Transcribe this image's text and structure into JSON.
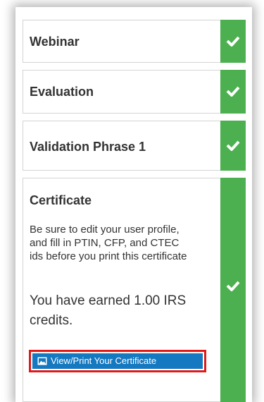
{
  "steps": [
    {
      "title": "Webinar",
      "status": "complete",
      "icon": "checkmark-icon"
    },
    {
      "title": "Evaluation",
      "status": "complete",
      "icon": "checkmark-icon"
    },
    {
      "title": "Validation Phrase 1",
      "status": "complete",
      "icon": "checkmark-icon"
    },
    {
      "title": "Certificate",
      "status": "complete",
      "icon": "checkmark-icon",
      "description": "Be sure to edit your user profile, and fill in PTIN, CFP, and CTEC ids before you print this certificate",
      "credits_text": "You have earned 1.00 IRS credits.",
      "button_label": "View/Print Your Certificate",
      "button_icon": "image-icon"
    }
  ],
  "colors": {
    "complete_green": "#4cb050",
    "button_blue": "#1479c0",
    "highlight_red": "#e01919"
  }
}
